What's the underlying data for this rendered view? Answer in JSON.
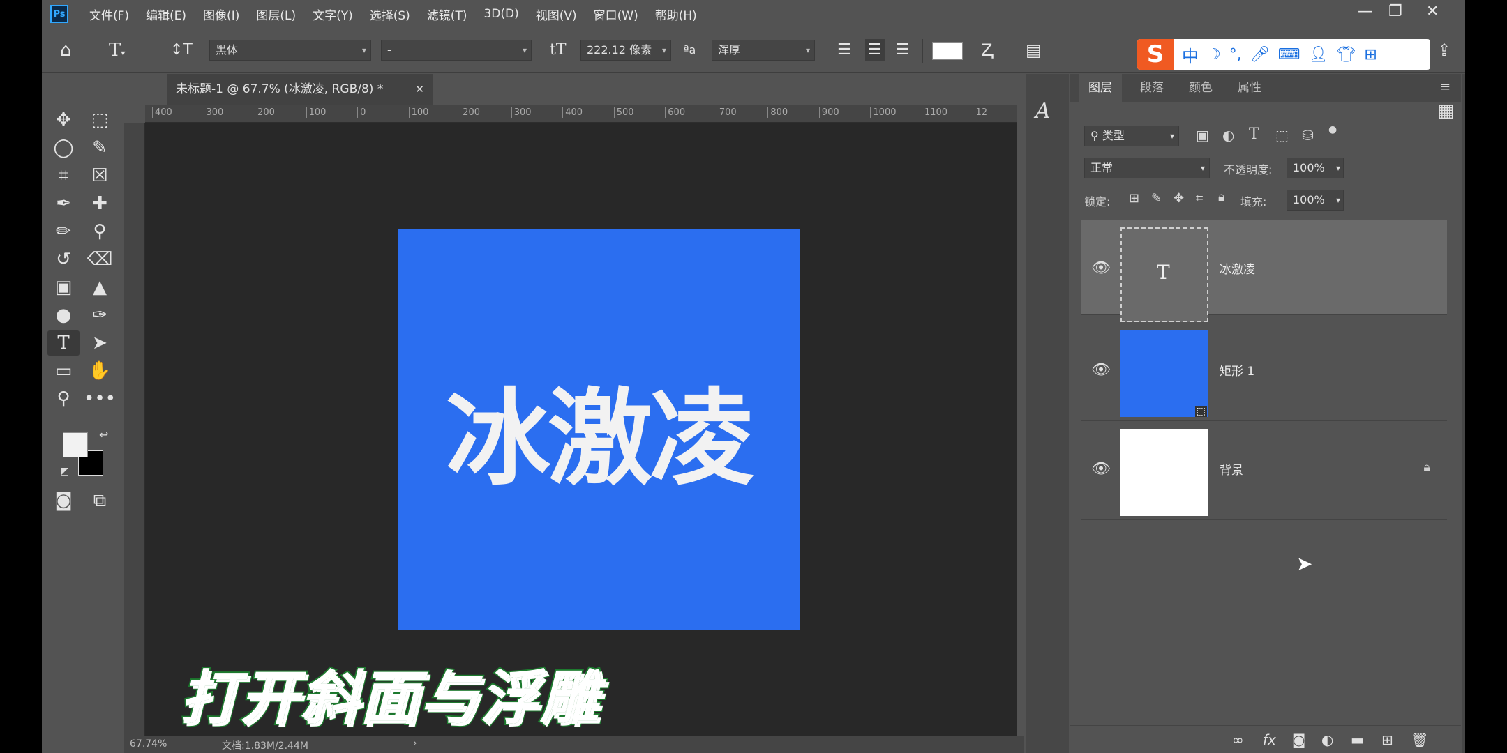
{
  "menu": {
    "app_logo": "Ps",
    "items": [
      "文件(F)",
      "编辑(E)",
      "图像(I)",
      "图层(L)",
      "文字(Y)",
      "选择(S)",
      "滤镜(T)",
      "3D(D)",
      "视图(V)",
      "窗口(W)",
      "帮助(H)"
    ]
  },
  "options": {
    "font_family": "黑体",
    "font_style": "-",
    "font_size": "222.12 像素",
    "antialias": "浑厚",
    "text_color": "#ffffff"
  },
  "ime": {
    "logo": "S",
    "mode": "中"
  },
  "document": {
    "tab_title": "未标题-1 @ 67.7% (冰激凌, RGB/8) *",
    "art_text": "冰激凌",
    "art_color": "#2b6ef0",
    "ruler_ticks": [
      "400",
      "300",
      "200",
      "100",
      "0",
      "100",
      "200",
      "300",
      "400",
      "500",
      "600",
      "700",
      "800",
      "900",
      "1000",
      "1100",
      "12"
    ]
  },
  "status": {
    "zoom": "67.74%",
    "doc_size": "文档:1.83M/2.44M"
  },
  "panel": {
    "tabs": [
      "图层",
      "段落",
      "颜色",
      "属性"
    ],
    "filter_label": "类型",
    "blend_mode": "正常",
    "opacity_label": "不透明度:",
    "opacity_value": "100%",
    "lock_label": "锁定:",
    "fill_label": "填充:",
    "fill_value": "100%",
    "layers": [
      {
        "name": "冰激凌",
        "kind": "text",
        "thumb_color": "#6a6a6a"
      },
      {
        "name": "矩形 1",
        "kind": "shape",
        "thumb_color": "#2b6ef0"
      },
      {
        "name": "背景",
        "kind": "background",
        "thumb_color": "#ffffff"
      }
    ]
  },
  "subtitle": "打开斜面与浮雕"
}
